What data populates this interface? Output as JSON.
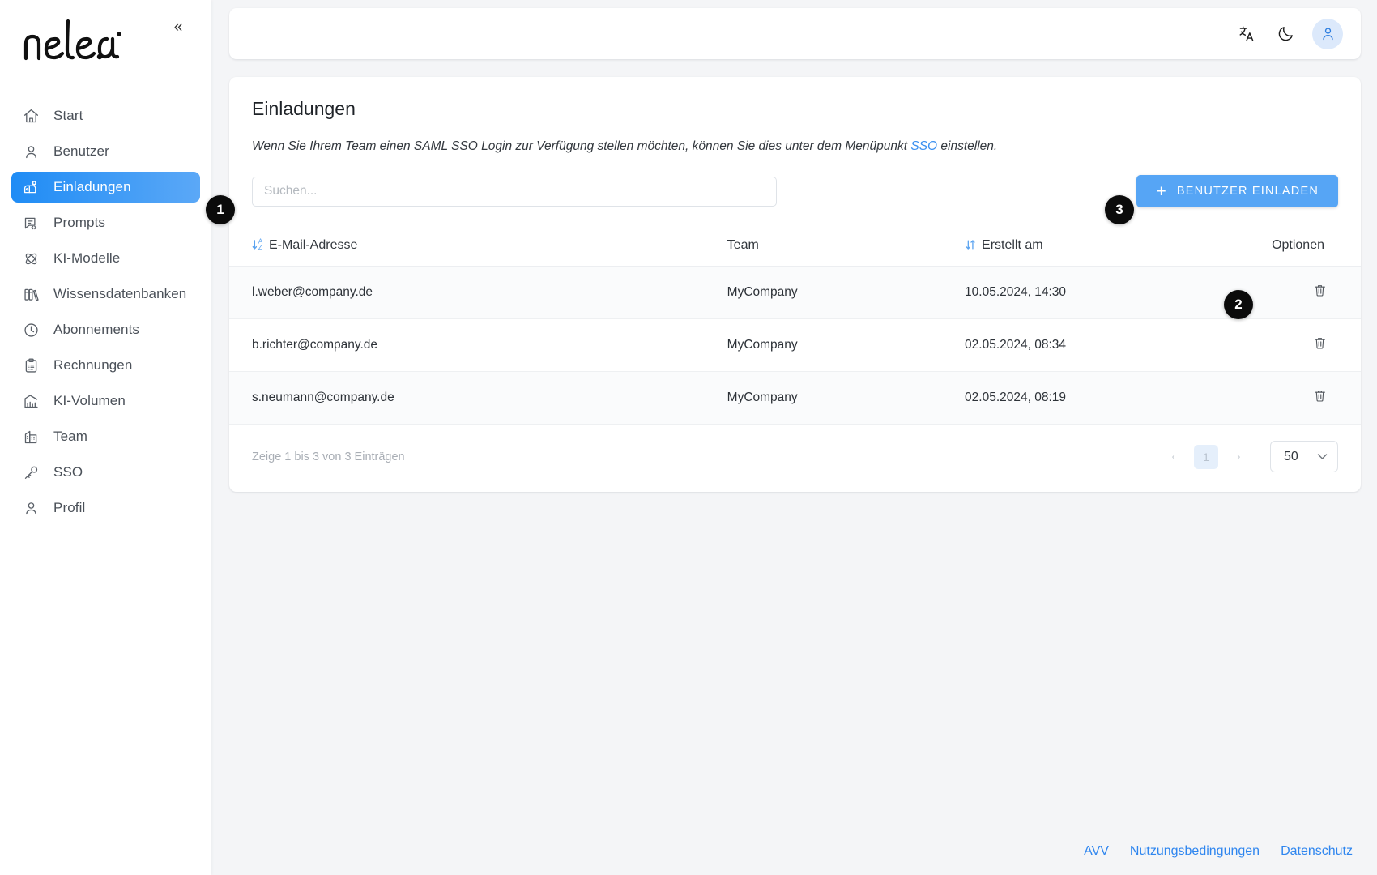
{
  "sidebar": {
    "logo_text": "nele.ai",
    "collapse_label": "«",
    "items": [
      {
        "label": "Start",
        "icon": "home-icon"
      },
      {
        "label": "Benutzer",
        "icon": "user-icon"
      },
      {
        "label": "Einladungen",
        "icon": "mailbox-icon",
        "active": true
      },
      {
        "label": "Prompts",
        "icon": "message-code-icon"
      },
      {
        "label": "KI-Modelle",
        "icon": "atom-icon"
      },
      {
        "label": "Wissensdatenbanken",
        "icon": "books-icon"
      },
      {
        "label": "Abonnements",
        "icon": "clock-icon"
      },
      {
        "label": "Rechnungen",
        "icon": "clipboard-icon"
      },
      {
        "label": "KI-Volumen",
        "icon": "chart-icon"
      },
      {
        "label": "Team",
        "icon": "building-icon"
      },
      {
        "label": "SSO",
        "icon": "key-icon"
      },
      {
        "label": "Profil",
        "icon": "user-icon"
      }
    ]
  },
  "topbar": {
    "translate_icon": "translate-icon",
    "dark_mode_icon": "moon-icon",
    "avatar_icon": "user-avatar-icon"
  },
  "page": {
    "title": "Einladungen",
    "description_before": "Wenn Sie Ihrem Team einen SAML SSO Login zur Verfügung stellen möchten, können Sie dies unter dem Menüpunkt ",
    "description_link": "SSO",
    "description_after": " einstellen."
  },
  "toolbar": {
    "search_placeholder": "Suchen...",
    "search_value": "",
    "invite_button_label": "BENUTZER EINLADEN",
    "invite_button_plus": "+"
  },
  "table": {
    "columns": [
      {
        "label": "E-Mail-Adresse",
        "sort": "az"
      },
      {
        "label": "Team",
        "sort": ""
      },
      {
        "label": "Erstellt am",
        "sort": "updown"
      },
      {
        "label": "Optionen",
        "sort": ""
      }
    ],
    "rows": [
      {
        "email": "l.weber@company.de",
        "team": "MyCompany",
        "created": "10.05.2024, 14:30",
        "delete_icon": "trash-icon"
      },
      {
        "email": "b.richter@company.de",
        "team": "MyCompany",
        "created": "02.05.2024, 08:34",
        "delete_icon": "trash-icon"
      },
      {
        "email": "s.neumann@company.de",
        "team": "MyCompany",
        "created": "02.05.2024, 08:19",
        "delete_icon": "trash-icon"
      }
    ]
  },
  "pagination": {
    "summary": "Zeige 1 bis 3 von 3 Einträgen",
    "prev_label": "‹",
    "current_page": "1",
    "next_label": "›",
    "per_page": "50",
    "per_page_chevron": "⌄"
  },
  "footer": {
    "links": [
      {
        "label": "AVV"
      },
      {
        "label": "Nutzungsbedingungen"
      },
      {
        "label": "Datenschutz"
      }
    ]
  },
  "annotations": [
    {
      "number": "1",
      "target": "search-input"
    },
    {
      "number": "2",
      "target": "row-delete-button"
    },
    {
      "number": "3",
      "target": "invite-user-button"
    }
  ],
  "colors": {
    "accent": "#56a5f5",
    "active_nav": "#1f8cf5",
    "link": "#2f86ef",
    "page_bg": "#f4f5f7"
  }
}
